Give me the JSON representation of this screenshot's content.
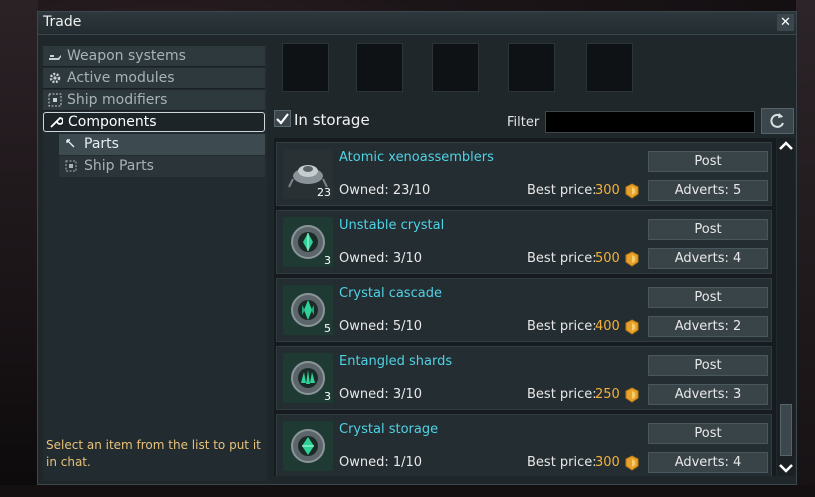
{
  "window": {
    "title": "Trade",
    "close_label": "✕"
  },
  "sidebar": {
    "categories": [
      {
        "label": "Weapon systems",
        "icon": "weapon-icon"
      },
      {
        "label": "Active modules",
        "icon": "gear-icon"
      },
      {
        "label": "Ship modifiers",
        "icon": "modifier-icon"
      },
      {
        "label": "Components",
        "icon": "wrench-icon",
        "selected": true
      }
    ],
    "subitems": [
      {
        "label": "Parts",
        "icon": "pointer-icon",
        "active": true
      },
      {
        "label": "Ship Parts",
        "icon": "modifier-icon",
        "active": false
      }
    ],
    "hint": "Select an item from the list to put it in chat."
  },
  "toolbar": {
    "in_storage_label": "In storage",
    "in_storage_checked": true,
    "filter_label": "Filter",
    "filter_value": ""
  },
  "items": [
    {
      "name": "Atomic xenoassemblers",
      "qty": "23",
      "owned": "Owned: 23/10",
      "best_price_label": "Best price:",
      "best_price": "300",
      "post_label": "Post",
      "adverts_label": "Adverts: 5"
    },
    {
      "name": "Unstable crystal",
      "qty": "3",
      "owned": "Owned: 3/10",
      "best_price_label": "Best price:",
      "best_price": "500",
      "post_label": "Post",
      "adverts_label": "Adverts: 4"
    },
    {
      "name": "Crystal cascade",
      "qty": "5",
      "owned": "Owned: 5/10",
      "best_price_label": "Best price:",
      "best_price": "400",
      "post_label": "Post",
      "adverts_label": "Adverts: 2"
    },
    {
      "name": "Entangled shards",
      "qty": "3",
      "owned": "Owned: 3/10",
      "best_price_label": "Best price:",
      "best_price": "250",
      "post_label": "Post",
      "adverts_label": "Adverts: 3"
    },
    {
      "name": "Crystal storage",
      "qty": "",
      "owned": "Owned: 1/10",
      "best_price_label": "Best price:",
      "best_price": "300",
      "post_label": "Post",
      "adverts_label": "Adverts: 4"
    }
  ],
  "colors": {
    "item_name": "#4fd3e6",
    "price": "#f2b23a",
    "hint": "#e8c27a",
    "accent_crystal": "#2fd39a"
  }
}
